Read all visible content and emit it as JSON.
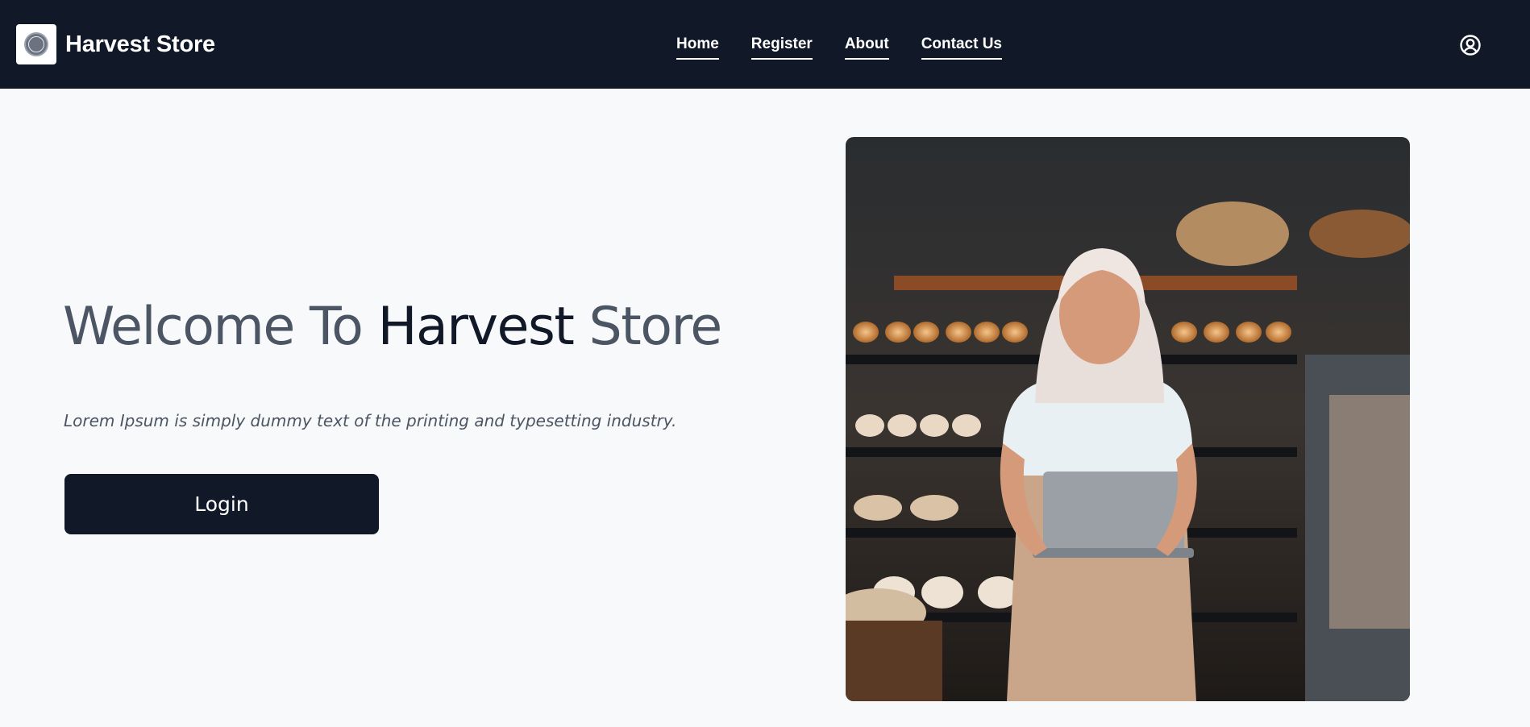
{
  "brand": {
    "name": "Harvest Store",
    "logo_icon": "store-seal-logo"
  },
  "nav": {
    "links": [
      {
        "label": "Home"
      },
      {
        "label": "Register"
      },
      {
        "label": "About"
      },
      {
        "label": "Contact Us"
      }
    ],
    "user_icon": "user-circle-icon"
  },
  "hero": {
    "title_part1": "Welcome To ",
    "title_part2": "Harvest",
    "title_part3": " Store",
    "subtitle": "Lorem Ipsum is simply dummy text of the printing and typesetting industry.",
    "login_label": "Login",
    "image_icon": "bakery-photo"
  },
  "colors": {
    "navbar_bg": "#111827",
    "page_bg": "#f8f9fb",
    "button_bg": "#111827",
    "title_gray": "#4b5563"
  }
}
